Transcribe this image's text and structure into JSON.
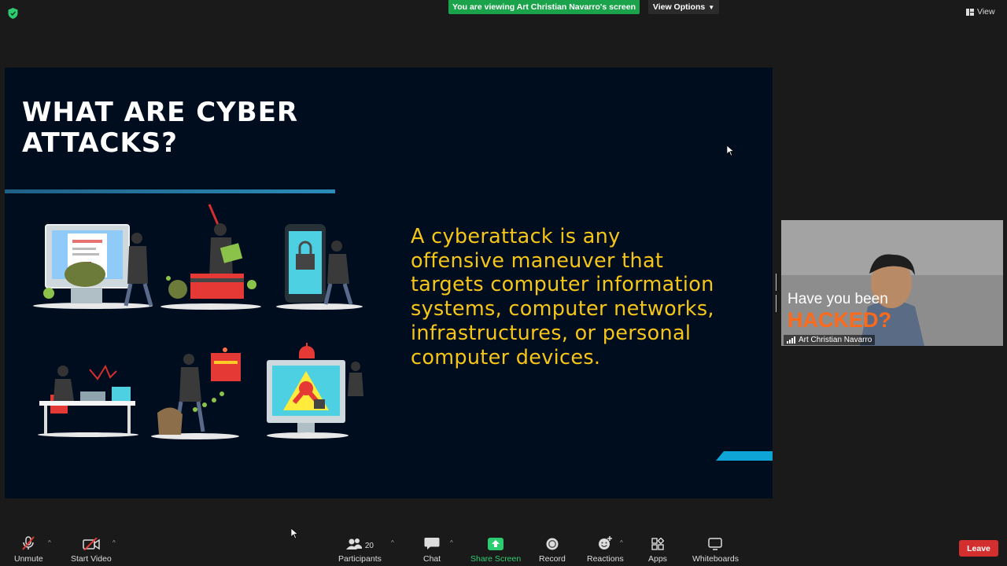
{
  "top": {
    "banner_text": "You are viewing Art Christian Navarro's screen",
    "view_options_label": "View Options",
    "view_label": "View"
  },
  "slide": {
    "title_line1": "WHAT ARE CYBER",
    "title_line2": "ATTACKS?",
    "body_lines": [
      "A cyberattack is any",
      "offensive maneuver that",
      "targets computer information",
      "systems, computer networks,",
      "infrastructures, or personal",
      "computer devices."
    ],
    "colors": {
      "background": "#000d1f",
      "body_text": "#f5c518",
      "accent": "#0ea5d6"
    }
  },
  "video": {
    "overlay_line1": "Have you been",
    "overlay_line2": "HACKED?",
    "participant_name": "Art Christian Navarro"
  },
  "toolbar": {
    "unmute": "Unmute",
    "start_video": "Start Video",
    "participants": "Participants",
    "participants_count": "20",
    "chat": "Chat",
    "share_screen": "Share Screen",
    "record": "Record",
    "reactions": "Reactions",
    "apps": "Apps",
    "whiteboards": "Whiteboards",
    "leave": "Leave"
  }
}
